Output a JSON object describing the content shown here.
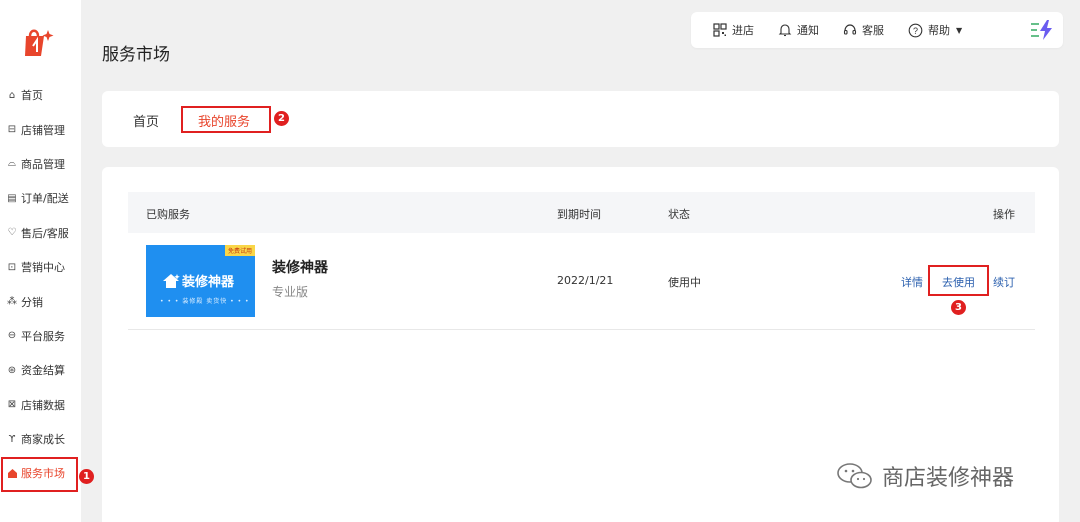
{
  "sidebar": {
    "items": [
      {
        "label": "首页",
        "icon": "home-icon"
      },
      {
        "label": "店铺管理",
        "icon": "store-icon"
      },
      {
        "label": "商品管理",
        "icon": "bag-icon"
      },
      {
        "label": "订单/配送",
        "icon": "order-icon"
      },
      {
        "label": "售后/客服",
        "icon": "service-icon"
      },
      {
        "label": "营销中心",
        "icon": "marketing-icon"
      },
      {
        "label": "分销",
        "icon": "distribution-icon"
      },
      {
        "label": "平台服务",
        "icon": "platform-icon"
      },
      {
        "label": "资金结算",
        "icon": "funds-icon"
      },
      {
        "label": "店铺数据",
        "icon": "chart-icon"
      },
      {
        "label": "商家成长",
        "icon": "sprout-icon"
      },
      {
        "label": "服务市场",
        "icon": "market-icon"
      }
    ],
    "active_index": 11
  },
  "annotations": {
    "badge1": "1",
    "badge2": "2",
    "badge3": "3"
  },
  "topbar": {
    "enter_store": "进店",
    "notify": "通知",
    "support": "客服",
    "help": "帮助"
  },
  "page": {
    "title": "服务市场"
  },
  "tabs": {
    "home": "首页",
    "mine": "我的服务"
  },
  "table": {
    "headers": {
      "service": "已购服务",
      "expire": "到期时间",
      "status": "状态",
      "action": "操作"
    },
    "rows": [
      {
        "thumb_tag": "免费试用",
        "thumb_title": "装修神器",
        "thumb_sub": "• • • 装修殿 卖货快 • • •",
        "name": "装修神器",
        "plan": "专业版",
        "expire": "2022/1/21",
        "status": "使用中",
        "actions": {
          "detail": "详情",
          "use": "去使用",
          "renew": "续订"
        }
      }
    ]
  },
  "watermark": "商店装修神器",
  "colors": {
    "accent": "#e8452c",
    "link": "#2a5fae",
    "highlight": "#e02020",
    "thumb_bg": "#1f8ff0"
  }
}
